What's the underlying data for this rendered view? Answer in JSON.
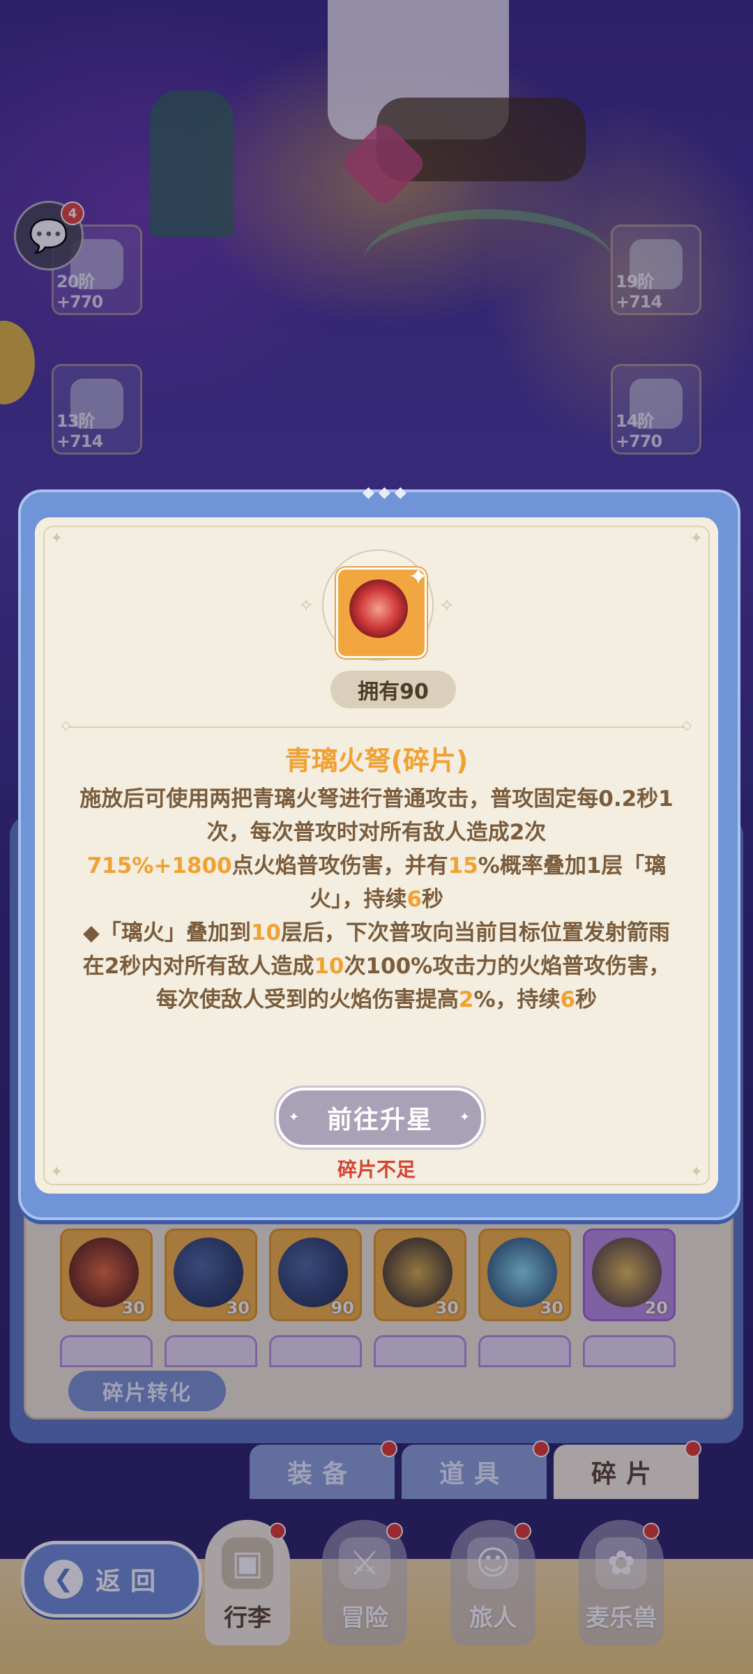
{
  "chat": {
    "unread_count": "4"
  },
  "equipment_slots": [
    {
      "tier": "20阶",
      "bonus": "+770"
    },
    {
      "tier": "19阶",
      "bonus": "+714"
    },
    {
      "tier": "13阶",
      "bonus": "+714"
    },
    {
      "tier": "14阶",
      "bonus": "+770"
    }
  ],
  "modal": {
    "owned_label": "拥有90",
    "title": "青璃火弩(碎片)",
    "desc_parts": {
      "p1": "施放后可使用两把青璃火弩进行普通攻击，普攻固定每0.2秒1次，每次普攻时对所有敌人造成2次",
      "p1_hl_a": "715",
      "p1_b": "%+",
      "p1_hl_b": "1800",
      "p1_c": "点火焰普攻伤害，并有",
      "p1_hl_c": "15",
      "p1_d": "%概率叠加1层「璃火」，持续",
      "p1_hl_d": "6",
      "p1_e": "秒",
      "p2_a": "◆「璃火」叠加到",
      "p2_hl_a": "10",
      "p2_b": "层后，下次普攻向当前目标位置发射箭雨在2秒内对所有敌人造成",
      "p2_hl_b": "10",
      "p2_c": "次100%攻击力的火焰普攻伤害，每次使敌人受到的火焰伤害提高",
      "p2_hl_c": "2",
      "p2_d": "%，持续",
      "p2_hl_d": "6",
      "p2_e": "秒"
    },
    "upgrade_button": "前往升星",
    "warning": "碎片不足"
  },
  "fragments": [
    {
      "count": "30"
    },
    {
      "count": "30"
    },
    {
      "count": "90"
    },
    {
      "count": "30"
    },
    {
      "count": "30"
    },
    {
      "count": "20"
    }
  ],
  "convert_button": "碎片转化",
  "category_tabs": [
    "装备",
    "道具",
    "碎片"
  ],
  "bottom_nav": [
    "行李",
    "冒险",
    "旅人",
    "麦乐兽"
  ],
  "back_button": "返回",
  "colors": {
    "accent_orange": "#f0a131",
    "warning_red": "#d8402f",
    "panel_blue": "#6f95d8",
    "card_cream": "#f3eee0"
  }
}
